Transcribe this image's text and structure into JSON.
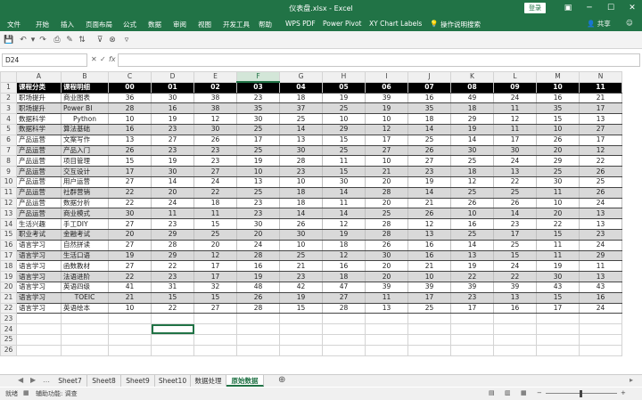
{
  "window": {
    "title": "仪表盘.xlsx - Excel",
    "login": "登录"
  },
  "ribbon": {
    "tabs": [
      "文件",
      "开始",
      "插入",
      "页面布局",
      "公式",
      "数据",
      "审阅",
      "视图",
      "开发工具",
      "帮助",
      "WPS PDF",
      "Power Pivot",
      "XY Chart Labels",
      "操作说明搜索"
    ],
    "share": "共享"
  },
  "formula_bar": {
    "name_box": "D24",
    "value": ""
  },
  "columns": [
    "A",
    "B",
    "C",
    "D",
    "E",
    "F",
    "G",
    "H",
    "I",
    "J",
    "K",
    "L",
    "M",
    "N"
  ],
  "selected_column": "F",
  "selected_cell": "D24",
  "header_row": [
    "课程分类",
    "课程明细",
    "00",
    "01",
    "02",
    "03",
    "04",
    "05",
    "06",
    "07",
    "08",
    "09",
    "10",
    "11"
  ],
  "rows": [
    [
      "职场提升",
      "商业图表",
      36,
      30,
      38,
      23,
      18,
      19,
      39,
      16,
      49,
      24,
      16,
      21
    ],
    [
      "职场提升",
      "Power BI",
      28,
      16,
      38,
      35,
      37,
      25,
      19,
      35,
      18,
      11,
      35,
      17
    ],
    [
      "数据科学",
      "Python",
      10,
      19,
      12,
      30,
      25,
      10,
      10,
      18,
      29,
      12,
      15,
      13
    ],
    [
      "数据科学",
      "算法基础",
      16,
      23,
      30,
      25,
      14,
      29,
      12,
      14,
      19,
      11,
      10,
      27
    ],
    [
      "产品运营",
      "文案写作",
      13,
      27,
      26,
      17,
      13,
      15,
      17,
      25,
      14,
      17,
      26,
      17
    ],
    [
      "产品运营",
      "产品入门",
      26,
      23,
      23,
      25,
      30,
      25,
      27,
      26,
      30,
      30,
      20,
      12
    ],
    [
      "产品运营",
      "项目管理",
      15,
      19,
      23,
      19,
      28,
      11,
      10,
      27,
      25,
      24,
      29,
      22
    ],
    [
      "产品运营",
      "交互设计",
      17,
      30,
      27,
      10,
      23,
      15,
      21,
      23,
      18,
      13,
      25,
      26
    ],
    [
      "产品运营",
      "用户运营",
      27,
      14,
      24,
      13,
      10,
      30,
      20,
      19,
      12,
      22,
      30,
      25
    ],
    [
      "产品运营",
      "社群营销",
      22,
      20,
      22,
      25,
      18,
      14,
      28,
      14,
      25,
      25,
      11,
      26
    ],
    [
      "产品运营",
      "数据分析",
      22,
      24,
      18,
      23,
      18,
      11,
      20,
      21,
      26,
      26,
      10,
      24
    ],
    [
      "产品运营",
      "商业模式",
      30,
      11,
      11,
      23,
      14,
      14,
      25,
      26,
      10,
      14,
      20,
      13
    ],
    [
      "生活兴趣",
      "手工DIY",
      27,
      23,
      15,
      30,
      26,
      12,
      28,
      12,
      16,
      23,
      22,
      13
    ],
    [
      "职业考试",
      "金融考试",
      20,
      29,
      25,
      20,
      30,
      19,
      28,
      13,
      25,
      17,
      15,
      23
    ],
    [
      "语言学习",
      "自然拼读",
      27,
      28,
      20,
      24,
      10,
      18,
      26,
      16,
      14,
      25,
      11,
      24
    ],
    [
      "语言学习",
      "生活口语",
      19,
      29,
      12,
      28,
      25,
      12,
      30,
      16,
      13,
      15,
      11,
      29
    ],
    [
      "语言学习",
      "函数教材",
      27,
      22,
      17,
      16,
      21,
      16,
      20,
      21,
      19,
      24,
      19,
      11
    ],
    [
      "语言学习",
      "法语进阶",
      22,
      23,
      17,
      19,
      23,
      18,
      20,
      10,
      22,
      22,
      30,
      13
    ],
    [
      "语言学习",
      "英语四级",
      41,
      31,
      32,
      48,
      42,
      47,
      39,
      39,
      39,
      39,
      43,
      43
    ],
    [
      "语言学习",
      "TOEIC",
      21,
      15,
      15,
      26,
      19,
      27,
      11,
      17,
      23,
      13,
      15,
      16
    ],
    [
      "语言学习",
      "英语绘本",
      10,
      22,
      27,
      28,
      15,
      28,
      13,
      25,
      17,
      16,
      17,
      24
    ]
  ],
  "empty_rows": [
    "23",
    "24",
    "25",
    "26"
  ],
  "sheet_tabs": [
    "Sheet7",
    "Sheet8",
    "Sheet9",
    "Sheet10",
    "数据处理",
    "原始数据"
  ],
  "active_sheet": "原始数据",
  "status": {
    "ready": "就绪",
    "accessibility": "辅助功能: 调查"
  },
  "colors": {
    "excel_green": "#217346",
    "header_black": "#000000",
    "band_gray": "#d9d9d9"
  }
}
